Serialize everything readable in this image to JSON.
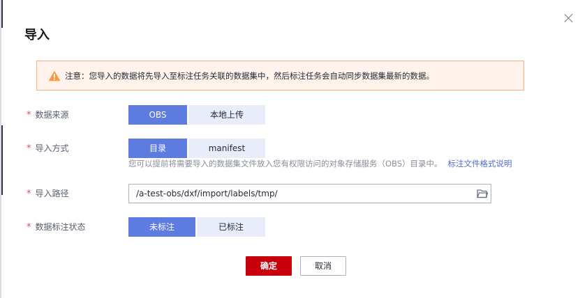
{
  "dialog": {
    "title": "导入",
    "notice": "注意：您导入的数据将先导入至标注任务关联的数据集中，然后标注任务会自动同步数据集最新的数据。"
  },
  "form": {
    "source": {
      "label": "数据来源",
      "options": [
        "OBS",
        "本地上传"
      ],
      "selected": "OBS"
    },
    "import_mode": {
      "label": "导入方式",
      "options": [
        "目录",
        "manifest"
      ],
      "selected": "目录",
      "hint": "您可以提前将需要导入的数据集文件放入您有权限访问的对象存储服务（OBS）目录中。",
      "hint_link": "标注文件格式说明"
    },
    "import_path": {
      "label": "导入路径",
      "value": "/a-test-obs/dxf/import/labels/tmp/"
    },
    "label_status": {
      "label": "数据标注状态",
      "options": [
        "未标注",
        "已标注"
      ],
      "selected": "未标注"
    },
    "required_mark": "*"
  },
  "footer": {
    "ok_label": "确定",
    "cancel_label": "取消"
  },
  "colors": {
    "primary": "#5e7ce0",
    "danger": "#c7000b",
    "warning": "#fa9841",
    "link": "#526ecc"
  }
}
